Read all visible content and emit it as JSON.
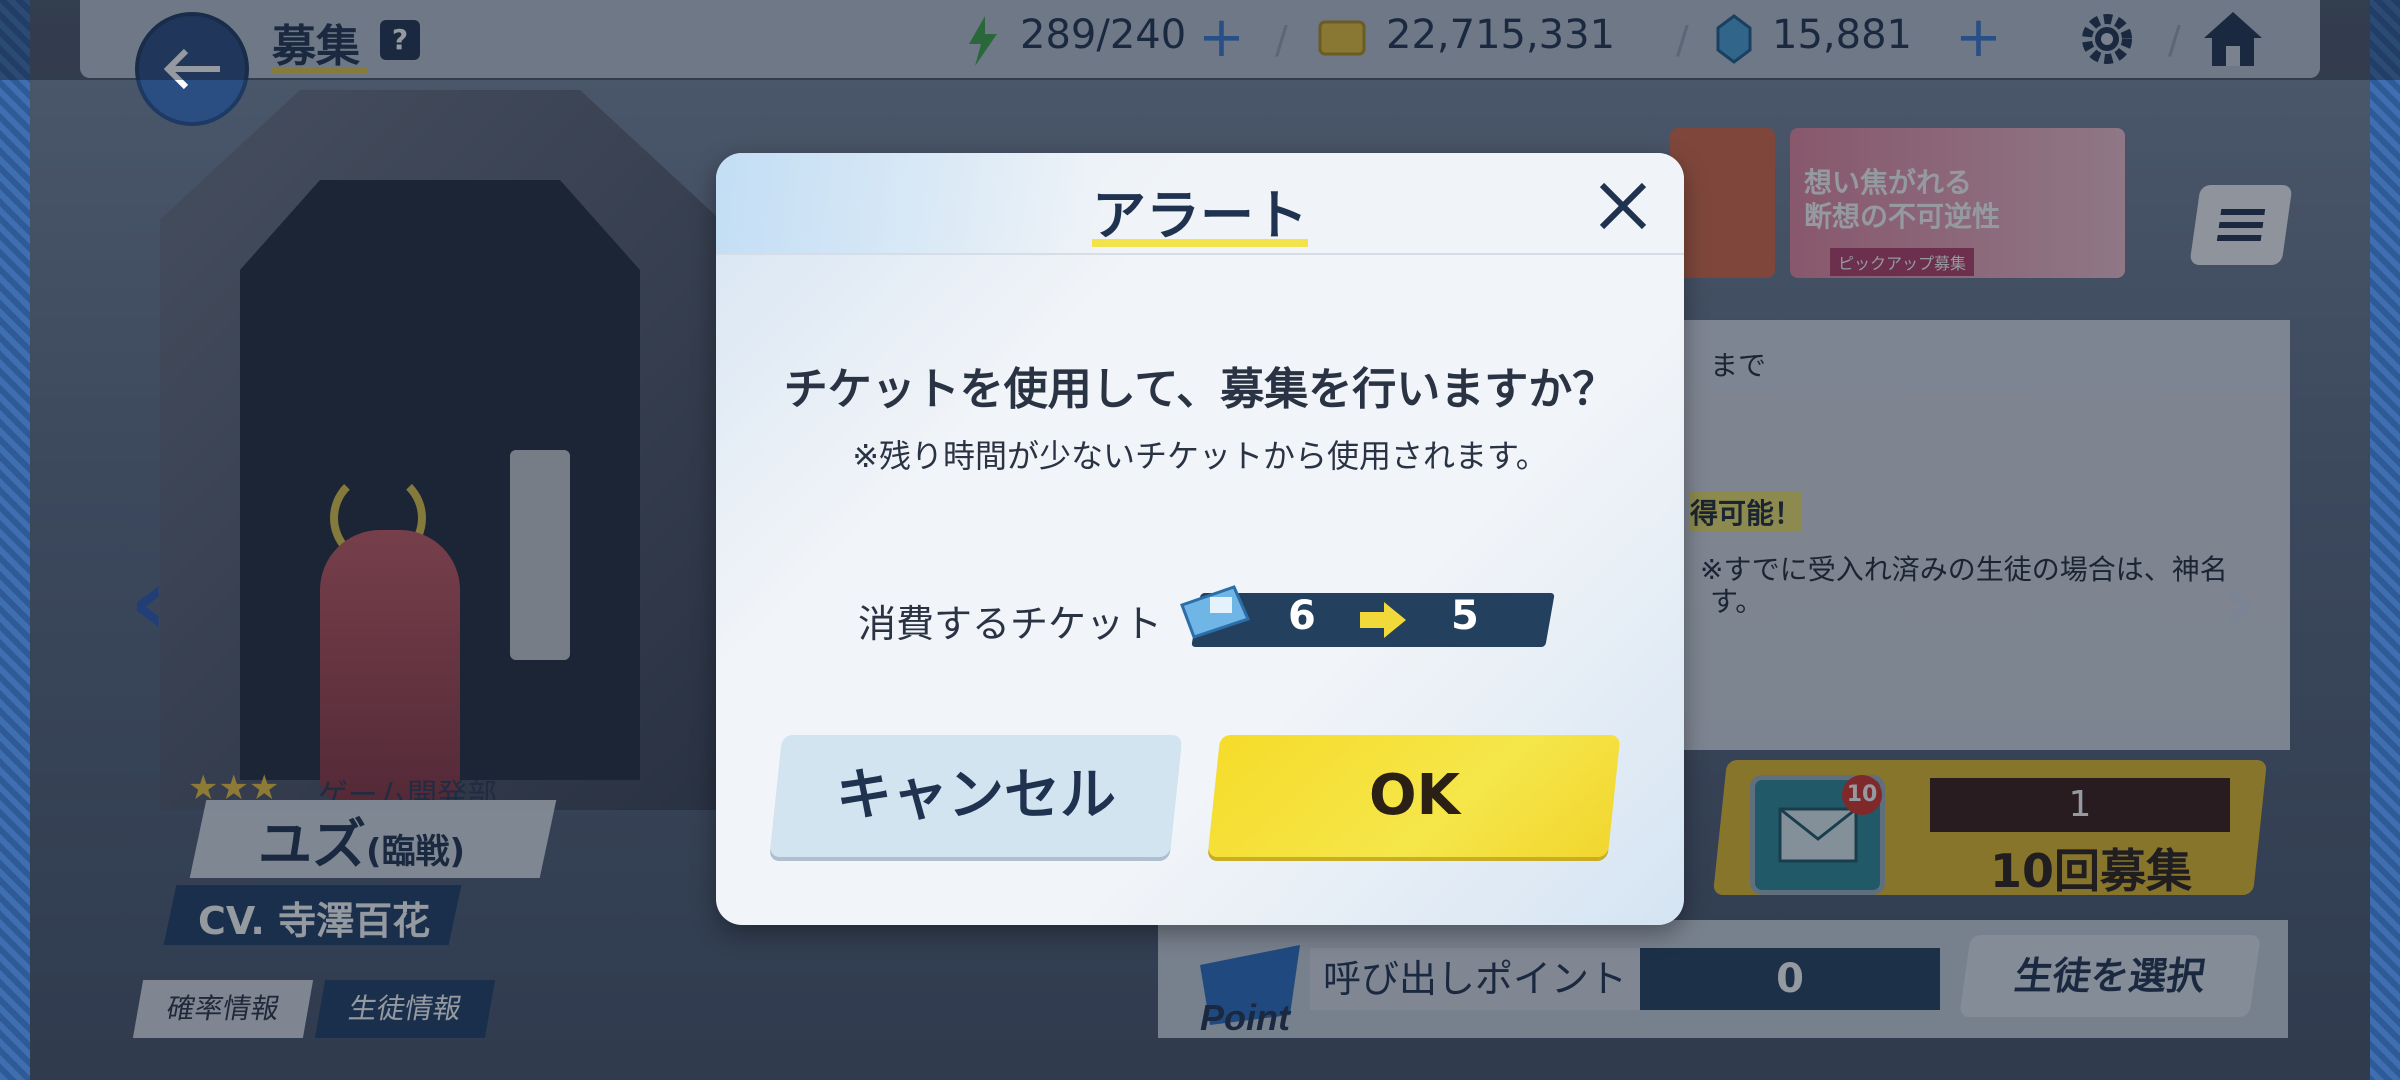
{
  "header": {
    "title": "募集",
    "help_label": "?",
    "ap": "289/240",
    "credits": "22,715,331",
    "pyroxene": "15,881"
  },
  "character": {
    "stars": "★★★",
    "club": "ゲーム開発部",
    "name": "ユズ",
    "name_suffix": "(臨戦)",
    "cv": "CV. 寺澤百花"
  },
  "bottom_left": {
    "rate_info": "確率情報",
    "student_info": "生徒情報"
  },
  "info_panel": {
    "line1": "まで",
    "line2": "得可能！",
    "line3": "※すでに受入れ済みの生徒の場合は、神名",
    "line4": "す。"
  },
  "banner_text": "想い焦がれる 断想の不可逆性",
  "banner_sub": "ピックアップ募集",
  "ten_pull": {
    "badge": "10",
    "count": "1",
    "label": "10回募集"
  },
  "points": {
    "label": "呼び出しポイント",
    "value": "0",
    "select_button": "生徒を選択",
    "logo_text": "Point"
  },
  "modal": {
    "title": "アラート",
    "question": "チケットを使用して、募集を行いますか？",
    "note": "※残り時間が少ないチケットから使用されます。",
    "consume_label": "消費するチケット",
    "ticket_from": "6",
    "ticket_to": "5",
    "cancel": "キャンセル",
    "ok": "OK"
  },
  "colors": {
    "accent_blue": "#24405f",
    "ok_yellow": "#f5e64a",
    "cancel_blue": "#d3e4f1"
  },
  "icons": [
    "back-arrow-icon",
    "question-icon",
    "lightning-icon",
    "credit-card-icon",
    "gem-icon",
    "plus-icon",
    "gear-icon",
    "home-icon",
    "close-icon",
    "ticket-icon",
    "arrow-right-icon",
    "menu-icon",
    "mail-icon",
    "chevron-left-icon",
    "chevron-right-icon"
  ]
}
